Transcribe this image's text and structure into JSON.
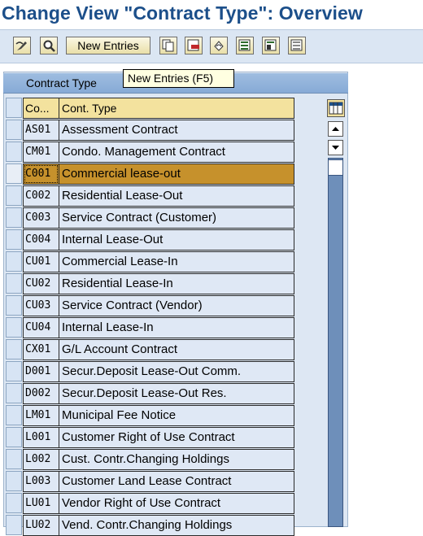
{
  "window": {
    "title": "Change View \"Contract Type\": Overview"
  },
  "toolbar": {
    "new_entries_label": "New Entries",
    "tooltip": "New Entries   (F5)",
    "icons": [
      "change-display-icon",
      "details-icon",
      "copy-as-icon",
      "delete-icon",
      "undo-change-icon",
      "select-all-icon",
      "select-block-icon",
      "deselect-all-icon"
    ]
  },
  "table": {
    "title": "Contract Type",
    "columns": {
      "code": "Co...",
      "name": "Cont. Type"
    },
    "selected_code": "C001",
    "rows": [
      {
        "code": "AS01",
        "name": "Assessment Contract"
      },
      {
        "code": "CM01",
        "name": "Condo. Management Contract"
      },
      {
        "code": "C001",
        "name": "Commercial lease-out"
      },
      {
        "code": "C002",
        "name": "Residential Lease-Out"
      },
      {
        "code": "C003",
        "name": "Service Contract (Customer)"
      },
      {
        "code": "C004",
        "name": "Internal Lease-Out"
      },
      {
        "code": "CU01",
        "name": "Commercial Lease-In"
      },
      {
        "code": "CU02",
        "name": "Residential Lease-In"
      },
      {
        "code": "CU03",
        "name": "Service Contract (Vendor)"
      },
      {
        "code": "CU04",
        "name": "Internal Lease-In"
      },
      {
        "code": "CX01",
        "name": "G/L Account Contract"
      },
      {
        "code": "D001",
        "name": "Secur.Deposit Lease-Out Comm."
      },
      {
        "code": "D002",
        "name": "Secur.Deposit Lease-Out Res."
      },
      {
        "code": "LM01",
        "name": "Municipal Fee Notice"
      },
      {
        "code": "L001",
        "name": "Customer Right of Use Contract"
      },
      {
        "code": "L002",
        "name": "Cust. Contr.Changing Holdings"
      },
      {
        "code": "L003",
        "name": "Customer Land Lease Contract"
      },
      {
        "code": "LU01",
        "name": "Vendor Right of Use Contract"
      },
      {
        "code": "LU02",
        "name": "Vend. Contr.Changing Holdings"
      }
    ]
  },
  "colors": {
    "title": "#1c4f8a",
    "selected_row": "#c6912c",
    "header": "#f3e29e"
  }
}
